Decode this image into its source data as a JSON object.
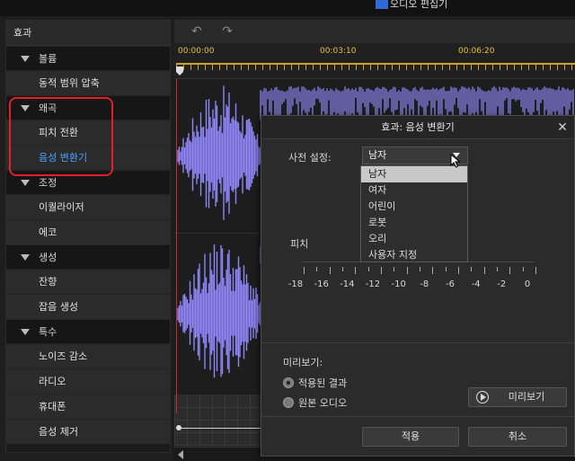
{
  "window": {
    "title": "오디오 편집기"
  },
  "effects_panel": {
    "header": "효과",
    "groups": [
      {
        "label": "볼륨",
        "items": [
          "동적 범위 압축"
        ]
      },
      {
        "label": "왜곡",
        "items": [
          "피치 전환",
          "음성 변환기"
        ]
      },
      {
        "label": "조정",
        "items": [
          "이퀄라이저",
          "에코"
        ]
      },
      {
        "label": "생성",
        "items": [
          "잔향",
          "잡음 생성"
        ]
      },
      {
        "label": "특수",
        "items": [
          "노이즈 감소",
          "라디오",
          "휴대폰",
          "음성 제거"
        ]
      }
    ],
    "selected_item": "음성 변환기"
  },
  "timeline": {
    "time_labels": [
      "00:00:00",
      "00:03:10",
      "00:06:20"
    ],
    "waveform_color": "#8f86f7"
  },
  "dialog": {
    "title": "효과: 음성 변환기",
    "preset_label": "사전 설정:",
    "preset_value": "남자",
    "preset_options": [
      "남자",
      "여자",
      "어린이",
      "로봇",
      "오리",
      "사용자 지정"
    ],
    "pitch_label": "피치",
    "pitch_scale": [
      "-18",
      "-16",
      "-14",
      "-12",
      "-10",
      "-8",
      "-6",
      "-4",
      "-2",
      "0"
    ],
    "preview_label": "미리보기:",
    "radio_applied": "적용된 결과",
    "radio_original": "원본 오디오",
    "preview_button": "미리보기",
    "apply_button": "적용",
    "cancel_button": "취소"
  },
  "colors": {
    "accent": "#4aa3ff",
    "highlight_box": "#e0202c",
    "playhead": "#d0262c",
    "ruler": "#c9a52e"
  }
}
